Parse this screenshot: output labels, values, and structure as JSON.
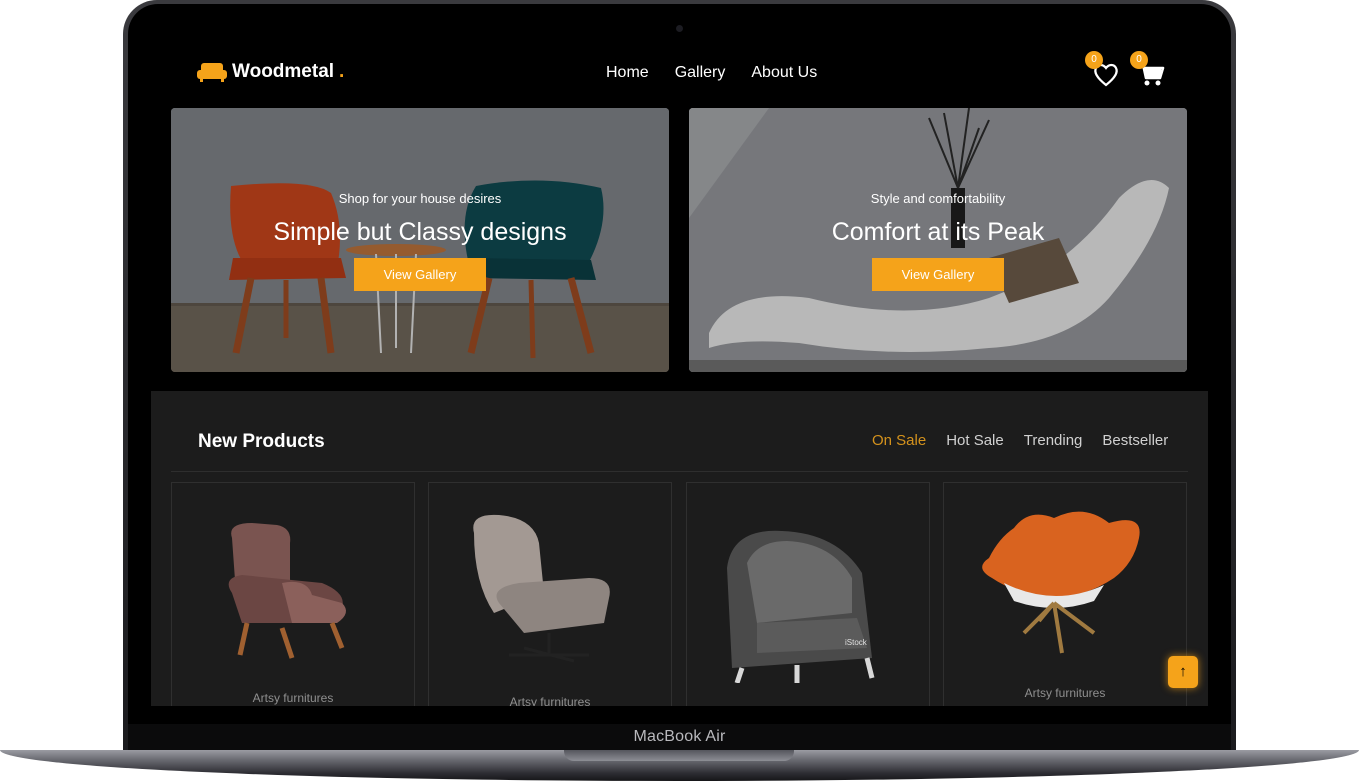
{
  "device": {
    "label": "MacBook Air"
  },
  "brand": {
    "name": "Woodmetal",
    "dot": ".",
    "accent": "#f5a31a"
  },
  "nav": {
    "items": [
      {
        "label": "Home"
      },
      {
        "label": "Gallery"
      },
      {
        "label": "About Us"
      }
    ]
  },
  "header_icons": {
    "wishlist_count": "0",
    "cart_count": "0",
    "wishlist_icon": "heart-icon",
    "cart_icon": "cart-icon"
  },
  "hero": [
    {
      "subtitle": "Shop for your house desires",
      "title": "Simple but Classy designs",
      "button": "View Gallery"
    },
    {
      "subtitle": "Style and comfortability",
      "title": "Comfort at its Peak",
      "button": "View Gallery"
    }
  ],
  "products": {
    "title": "New Products",
    "tabs": [
      {
        "label": "On Sale"
      },
      {
        "label": "Hot Sale"
      },
      {
        "label": "Trending"
      },
      {
        "label": "Bestseller"
      }
    ],
    "active_tab": "On Sale",
    "items": [
      {
        "caption": "Artsy furnitures"
      },
      {
        "caption": "Artsy furnitures"
      },
      {
        "caption": "",
        "watermark": "iStock"
      },
      {
        "caption": "Artsy furnitures"
      }
    ]
  },
  "scroll_top": {
    "icon": "arrow-up-icon",
    "glyph": "↑"
  }
}
